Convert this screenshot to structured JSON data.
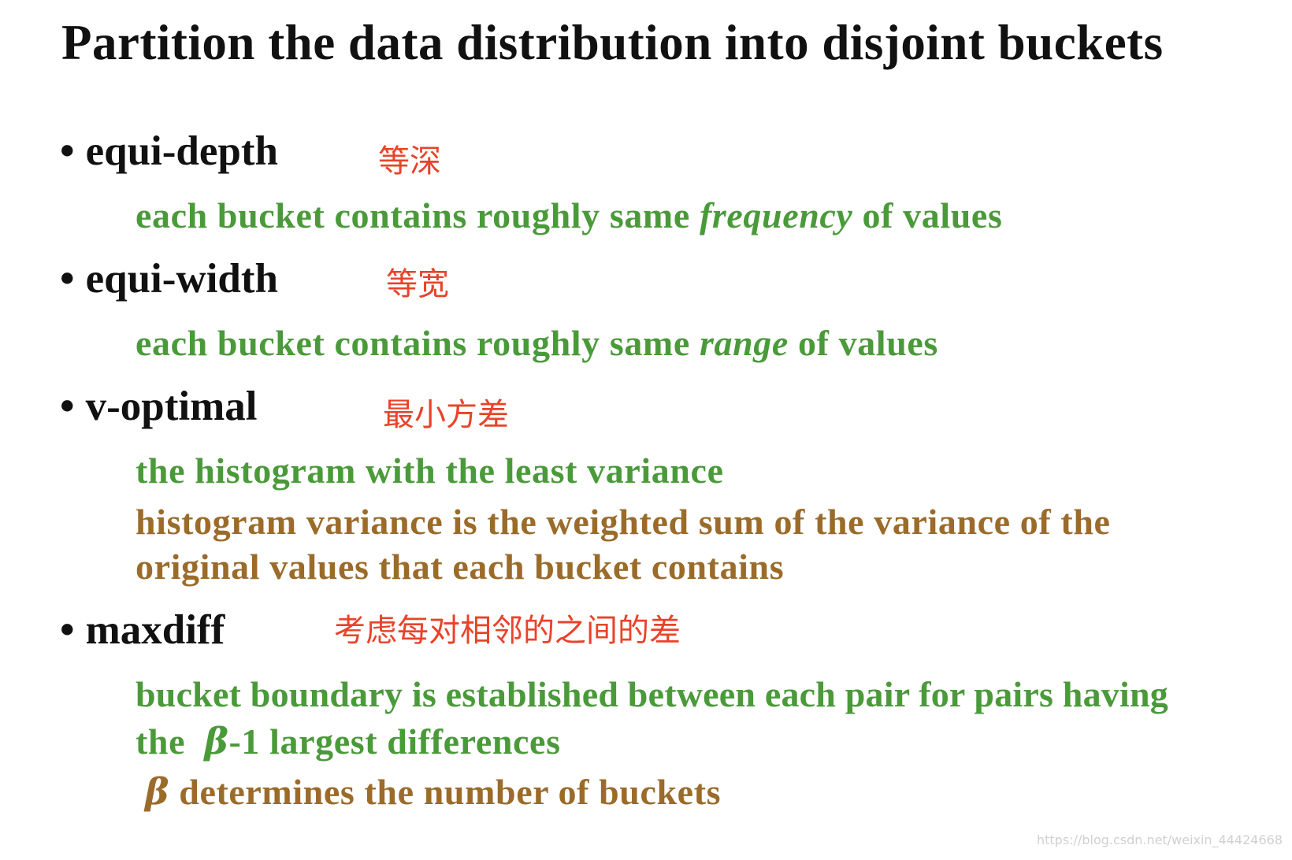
{
  "title": "Partition the data distribution into disjoint buckets",
  "bullet_char": "•",
  "items": [
    {
      "term": "equi-depth",
      "zh": "等深",
      "desc": {
        "pre": "each bucket contains roughly same ",
        "em": "frequency",
        "post": " of values"
      }
    },
    {
      "term": "equi-width",
      "zh": "等宽",
      "desc": {
        "pre": "each bucket contains roughly same ",
        "em": "range",
        "post": " of values"
      }
    },
    {
      "term": "v-optimal",
      "zh": "最小方差",
      "desc_green": "the histogram with the least variance",
      "desc_brown_1": "histogram variance is the weighted sum of the variance of the",
      "desc_brown_2": "original values that each bucket contains"
    },
    {
      "term": "maxdiff",
      "zh": "考虑每对相邻的之间的差",
      "desc_line1": "bucket boundary is established between each pair for pairs having",
      "desc_line2_pre": "the  ",
      "beta": "β",
      "desc_line2_post": "-1 largest differences",
      "desc_line3_post": " determines the number of buckets"
    }
  ],
  "watermark": "https://blog.csdn.net/weixin_44424668",
  "colors": {
    "green": "#4a9a3a",
    "brown": "#9b6b2a",
    "red": "#e8432a",
    "text": "#111111"
  }
}
